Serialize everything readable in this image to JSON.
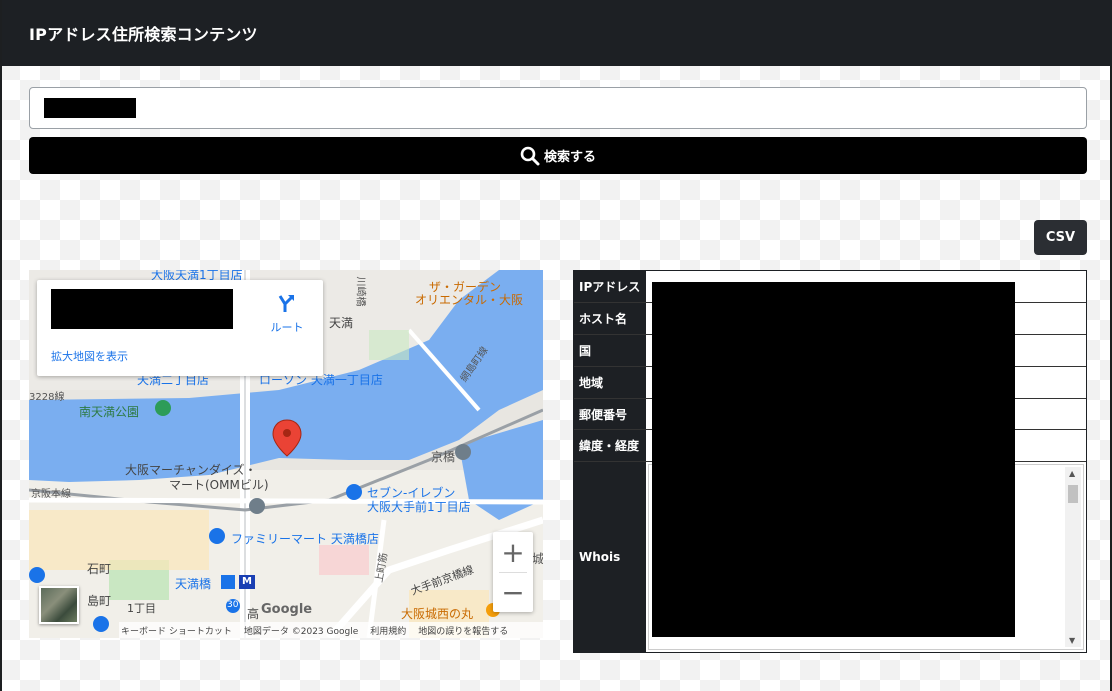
{
  "header": {
    "title": "IPアドレス住所検索コンテンツ"
  },
  "search": {
    "value": "",
    "button_label": "検索する"
  },
  "csv_label": "CSV",
  "map": {
    "card": {
      "route_label": "ルート",
      "enlarge_label": "拡大地図を表示"
    },
    "labels": [
      "ザ・ガーデン",
      "オリエンタル・大阪",
      "天満",
      "ローソン 天満一丁目店",
      "南天満公園",
      "京橋",
      "大阪マーチャンダイズ・",
      "マート(OMMビル)",
      "セブン-イレブン",
      "大阪大手前1丁目店",
      "ファミリーマート 天満橋店",
      "天満橋",
      "石町",
      "島町",
      "1丁目",
      "大手前京橋線",
      "大阪城西の丸",
      "川崎橋",
      "網島町線",
      "上町筋",
      "3228線",
      "大阪天満1丁目店",
      "天満二丁目店",
      "30",
      "M",
      "京阪本線",
      "城",
      "高"
    ],
    "footer": [
      "キーボード ショートカット",
      "地図データ ©2023 Google",
      "利用規約",
      "地図の誤りを報告する"
    ],
    "google": "Google",
    "zoom_in": "+",
    "zoom_out": "−"
  },
  "info": {
    "rows": [
      {
        "label": "IPアドレス",
        "value": ""
      },
      {
        "label": "ホスト名",
        "value": ""
      },
      {
        "label": "国",
        "value": ""
      },
      {
        "label": "地域",
        "value": ""
      },
      {
        "label": "郵便番号",
        "value": ""
      },
      {
        "label": "緯度・経度",
        "value": ""
      },
      {
        "label": "Whois",
        "value": ""
      }
    ]
  },
  "colors": {
    "header_bg": "#1d2024",
    "button_bg": "#000000",
    "map_water": "#4d8fe3",
    "map_road": "#ffffff",
    "pin": "#ea4335"
  }
}
